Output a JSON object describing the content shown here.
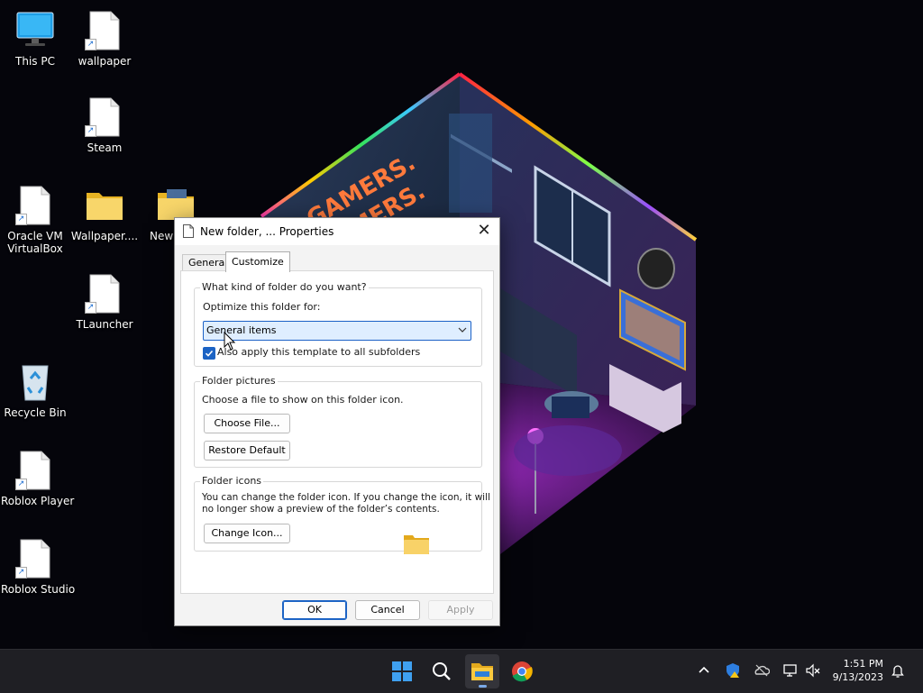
{
  "desktop": {
    "icons": [
      {
        "label": "This PC"
      },
      {
        "label": "wallpaper"
      },
      {
        "label": "Steam"
      },
      {
        "label": "Oracle VM VirtualBox"
      },
      {
        "label": "Wallpaper...."
      },
      {
        "label": "New"
      },
      {
        "label": "TLauncher"
      },
      {
        "label": "Recycle Bin"
      },
      {
        "label": "Roblox Player"
      },
      {
        "label": "Roblox Studio"
      }
    ],
    "wallpaper_text": [
      "GAMERS.",
      "GAMERS."
    ]
  },
  "dialog": {
    "title": "New folder, ... Properties",
    "tabs": [
      {
        "label": "General",
        "active": false
      },
      {
        "label": "Customize",
        "active": true
      }
    ],
    "group_optimize": {
      "legend": "What kind of folder do you want?",
      "optimize_label": "Optimize this folder for:",
      "selected": "General items",
      "checkbox_label": "Also apply this template to all subfolders",
      "checkbox_checked": true
    },
    "group_pictures": {
      "legend": "Folder pictures",
      "description": "Choose a file to show on this folder icon.",
      "choose_file": "Choose File...",
      "restore_default": "Restore Default"
    },
    "group_icons": {
      "legend": "Folder icons",
      "description_line1": "You can change the folder icon. If you change the icon, it will",
      "description_line2": "no longer show a preview of the folder’s contents.",
      "change_icon": "Change Icon..."
    },
    "buttons": {
      "ok": "OK",
      "cancel": "Cancel",
      "apply": "Apply"
    }
  },
  "taskbar": {
    "apps": [
      "start-icon",
      "search-icon",
      "file-explorer-icon",
      "chrome-icon"
    ],
    "tray": [
      "chevron-up-icon",
      "windows-security-icon",
      "onedrive-icon",
      "network-icon",
      "volume-muted-icon",
      "notification-bell-icon"
    ],
    "time": "1:51 PM",
    "date": "9/13/2023"
  },
  "colors": {
    "accent": "#1c63c4",
    "taskbar": "#1f1f24",
    "folder_yellow": "#f4c542"
  }
}
